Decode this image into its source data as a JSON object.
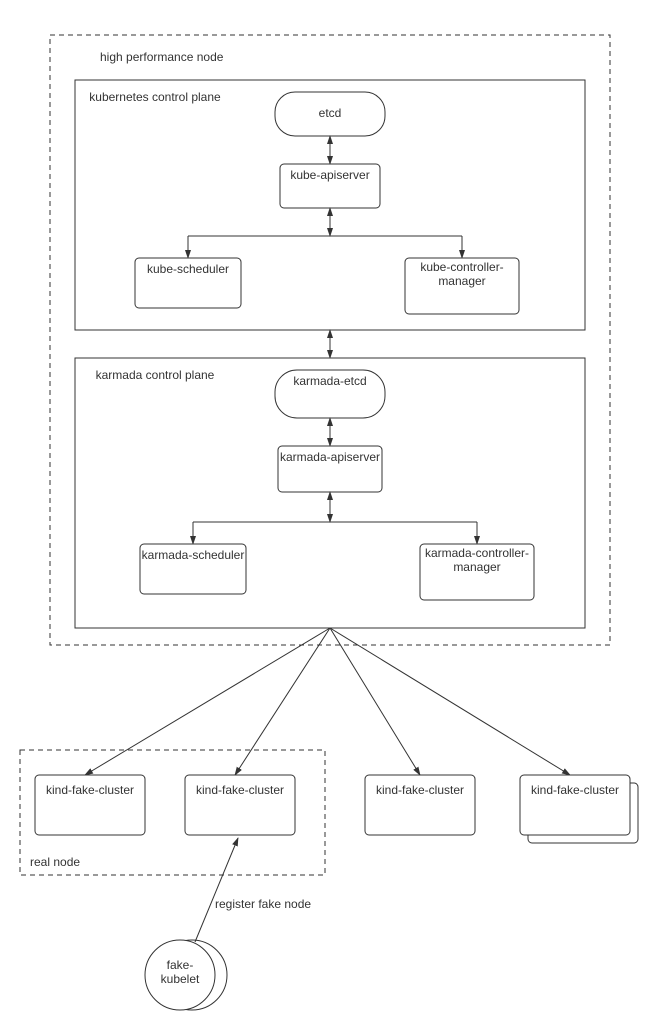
{
  "outer": {
    "title": "high performance node"
  },
  "k8s": {
    "title": "kubernetes control plane",
    "etcd": "etcd",
    "apiserver": "kube-apiserver",
    "scheduler": "kube-scheduler",
    "controller": "kube-controller-manager"
  },
  "karmada": {
    "title": "karmada control plane",
    "etcd": "karmada-etcd",
    "apiserver": "karmada-apiserver",
    "scheduler": "karmada-scheduler",
    "controller": "karmada-controller-manager"
  },
  "clusters": {
    "c1": "kind-fake-cluster",
    "c2": "kind-fake-cluster",
    "c3": "kind-fake-cluster",
    "c4": "kind-fake-cluster"
  },
  "real_node_label": "real node",
  "register_label": "register fake node",
  "fake_kubelet": "fake-kubelet"
}
